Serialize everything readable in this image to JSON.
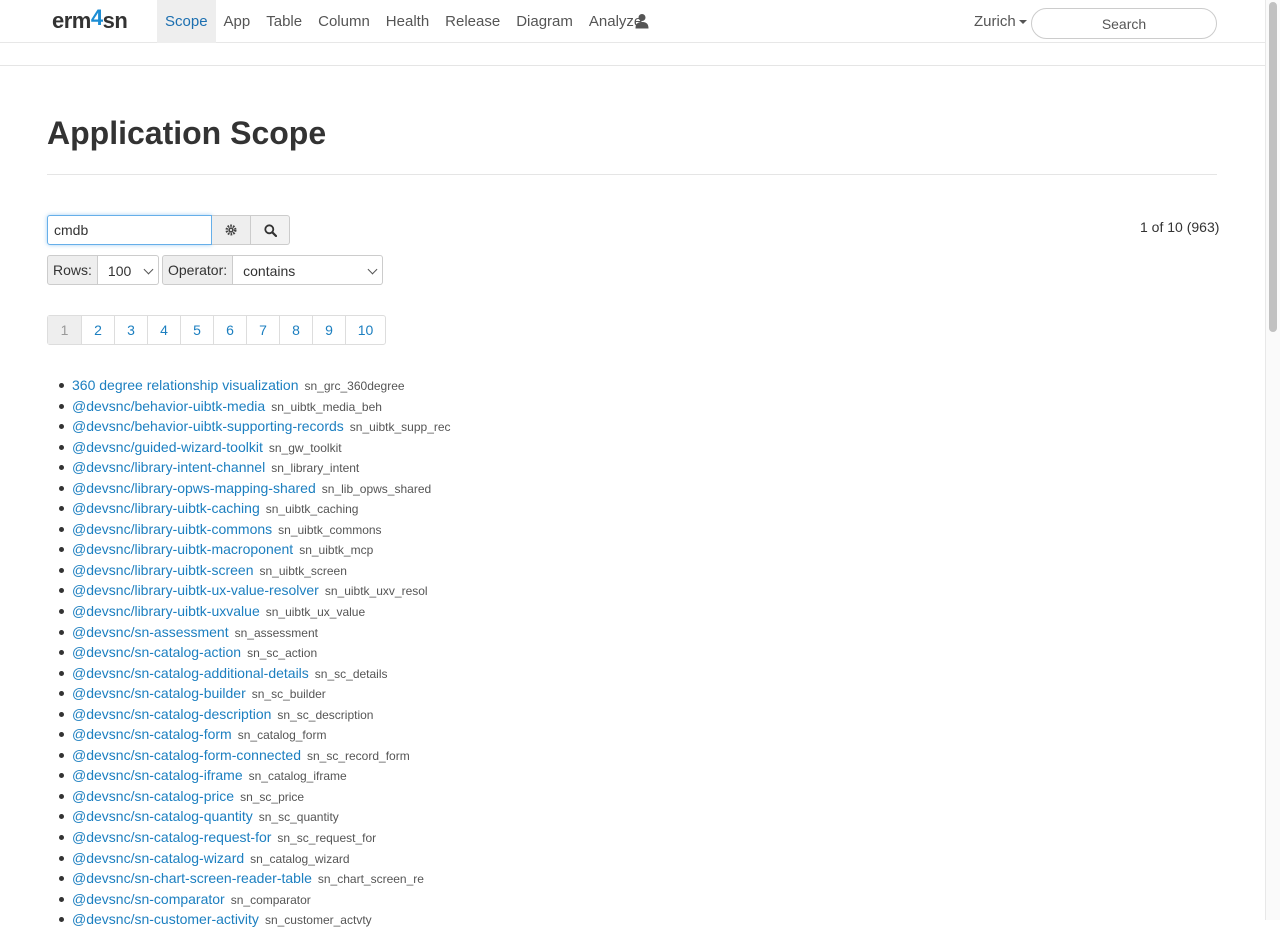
{
  "brand": {
    "part1": "erm",
    "part2": "4",
    "part3": "sn"
  },
  "nav": {
    "items": [
      {
        "label": "Scope"
      },
      {
        "label": "App"
      },
      {
        "label": "Table"
      },
      {
        "label": "Column"
      },
      {
        "label": "Health"
      },
      {
        "label": "Release"
      },
      {
        "label": "Diagram"
      },
      {
        "label": "Analyze"
      }
    ],
    "active": "Scope",
    "user_icon": "user-icon",
    "locale": "Zurich",
    "search_placeholder": "Search"
  },
  "page": {
    "title": "Application Scope"
  },
  "filter": {
    "value": "cmdb",
    "settings_icon": "gear-icon",
    "search_icon": "search-icon",
    "count": "1 of 10 (963)"
  },
  "rows": {
    "label": "Rows:",
    "value": "100"
  },
  "operator": {
    "label": "Operator:",
    "value": "contains"
  },
  "pagination": {
    "pages": [
      "1",
      "2",
      "3",
      "4",
      "5",
      "6",
      "7",
      "8",
      "9",
      "10"
    ],
    "current": "1"
  },
  "apps": [
    {
      "name": "360 degree relationship visualization",
      "code": "sn_grc_360degree"
    },
    {
      "name": "@devsnc/behavior-uibtk-media",
      "code": "sn_uibtk_media_beh"
    },
    {
      "name": "@devsnc/behavior-uibtk-supporting-records",
      "code": "sn_uibtk_supp_rec"
    },
    {
      "name": "@devsnc/guided-wizard-toolkit",
      "code": "sn_gw_toolkit"
    },
    {
      "name": "@devsnc/library-intent-channel",
      "code": "sn_library_intent"
    },
    {
      "name": "@devsnc/library-opws-mapping-shared",
      "code": "sn_lib_opws_shared"
    },
    {
      "name": "@devsnc/library-uibtk-caching",
      "code": "sn_uibtk_caching"
    },
    {
      "name": "@devsnc/library-uibtk-commons",
      "code": "sn_uibtk_commons"
    },
    {
      "name": "@devsnc/library-uibtk-macroponent",
      "code": "sn_uibtk_mcp"
    },
    {
      "name": "@devsnc/library-uibtk-screen",
      "code": "sn_uibtk_screen"
    },
    {
      "name": "@devsnc/library-uibtk-ux-value-resolver",
      "code": "sn_uibtk_uxv_resol"
    },
    {
      "name": "@devsnc/library-uibtk-uxvalue",
      "code": "sn_uibtk_ux_value"
    },
    {
      "name": "@devsnc/sn-assessment",
      "code": "sn_assessment"
    },
    {
      "name": "@devsnc/sn-catalog-action",
      "code": "sn_sc_action"
    },
    {
      "name": "@devsnc/sn-catalog-additional-details",
      "code": "sn_sc_details"
    },
    {
      "name": "@devsnc/sn-catalog-builder",
      "code": "sn_sc_builder"
    },
    {
      "name": "@devsnc/sn-catalog-description",
      "code": "sn_sc_description"
    },
    {
      "name": "@devsnc/sn-catalog-form",
      "code": "sn_catalog_form"
    },
    {
      "name": "@devsnc/sn-catalog-form-connected",
      "code": "sn_sc_record_form"
    },
    {
      "name": "@devsnc/sn-catalog-iframe",
      "code": "sn_catalog_iframe"
    },
    {
      "name": "@devsnc/sn-catalog-price",
      "code": "sn_sc_price"
    },
    {
      "name": "@devsnc/sn-catalog-quantity",
      "code": "sn_sc_quantity"
    },
    {
      "name": "@devsnc/sn-catalog-request-for",
      "code": "sn_sc_request_for"
    },
    {
      "name": "@devsnc/sn-catalog-wizard",
      "code": "sn_catalog_wizard"
    },
    {
      "name": "@devsnc/sn-chart-screen-reader-table",
      "code": "sn_chart_screen_re"
    },
    {
      "name": "@devsnc/sn-comparator",
      "code": "sn_comparator"
    },
    {
      "name": "@devsnc/sn-customer-activity",
      "code": "sn_customer_actvty"
    }
  ]
}
